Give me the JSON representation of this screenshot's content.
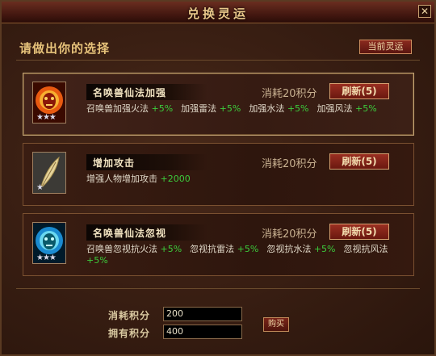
{
  "window": {
    "title": "兑换灵运",
    "close_label": "✕"
  },
  "prompt": "请做出你的选择",
  "current_button": "当前灵运",
  "cards": [
    {
      "name": "名唤兽仙法加强",
      "cost": "消耗20积分",
      "refresh": "刷新(5)",
      "icon": "fire-beast-icon",
      "stars": "★★★",
      "effects": [
        {
          "text": "召唤兽加强火法",
          "bonus": "+5%"
        },
        {
          "text": "加强雷法",
          "bonus": "+5%"
        },
        {
          "text": "加强水法",
          "bonus": "+5%"
        },
        {
          "text": "加强风法",
          "bonus": "+5%"
        }
      ]
    },
    {
      "name": "增加攻击",
      "cost": "消耗20积分",
      "refresh": "刷新(5)",
      "icon": "feather-icon",
      "stars": "★",
      "effects": [
        {
          "text": "增强人物增加攻击",
          "bonus": "+2000"
        }
      ]
    },
    {
      "name": "名唤兽仙法忽视",
      "cost": "消耗20积分",
      "refresh": "刷新(5)",
      "icon": "ice-beast-icon",
      "stars": "★★★",
      "effects": [
        {
          "text": "召唤兽忽视抗火法",
          "bonus": "+5%"
        },
        {
          "text": "忽视抗雷法",
          "bonus": "+5%"
        },
        {
          "text": "忽视抗水法",
          "bonus": "+5%"
        },
        {
          "text": "忽视抗风法",
          "bonus": "+5%"
        }
      ]
    }
  ],
  "footer": {
    "cost_label": "消耗积分",
    "cost_value": "200",
    "owned_label": "拥有积分",
    "owned_value": "400",
    "buy_label": "购买"
  },
  "colors": {
    "bonus": "#3ccc3c",
    "title": "#e9c88a",
    "button": "#8a2a1e"
  }
}
